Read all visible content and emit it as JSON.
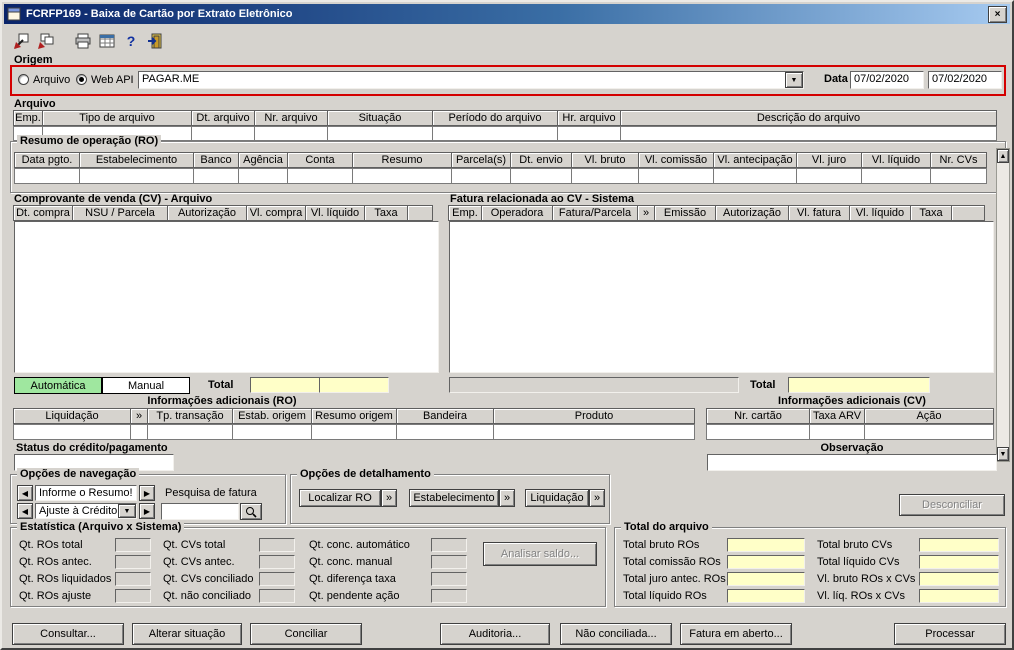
{
  "window": {
    "title": "FCRFP169 - Baixa de Cartão por Extrato Eletrônico"
  },
  "origem": {
    "label": "Origem",
    "options": [
      "Arquivo",
      "Web API"
    ],
    "selected": "Web API",
    "operadora": "PAGAR.ME",
    "data_label": "Data",
    "data_inicio": "07/02/2020",
    "data_fim": "07/02/2020"
  },
  "arquivo": {
    "label": "Arquivo",
    "columns": [
      "Emp.",
      "Tipo de arquivo",
      "Dt. arquivo",
      "Nr. arquivo",
      "Situação",
      "Período do arquivo",
      "Hr. arquivo",
      "Descrição do arquivo"
    ]
  },
  "resumo_ro": {
    "label": "Resumo de operação (RO)",
    "columns": [
      "Data pgto.",
      "Estabelecimento",
      "Banco",
      "Agência",
      "Conta",
      "Resumo",
      "Parcela(s)",
      "Dt. envio",
      "Vl. bruto",
      "Vl. comissão",
      "Vl. antecipação",
      "Vl. juro",
      "Vl. líquido",
      "Nr. CVs"
    ]
  },
  "cv_arquivo": {
    "label": "Comprovante de venda (CV) - Arquivo",
    "columns": [
      "Dt. compra",
      "NSU / Parcela",
      "Autorização",
      "Vl. compra",
      "Vl. líquido",
      "Taxa"
    ]
  },
  "fatura_sistema": {
    "label": "Fatura relacionada ao CV - Sistema",
    "columns": [
      "Emp.",
      "Operadora",
      "Fatura/Parcela",
      "»",
      "Emissão",
      "Autorização",
      "Vl. fatura",
      "Vl. líquido",
      "Taxa"
    ]
  },
  "conciliacao": {
    "automatica": "Automática",
    "manual": "Manual",
    "total_label": "Total"
  },
  "info_ro": {
    "label": "Informações adicionais (RO)",
    "columns": [
      "Liquidação",
      "»",
      "Tp. transação",
      "Estab. origem",
      "Resumo origem",
      "Bandeira",
      "Produto"
    ],
    "status_label": "Status do crédito/pagamento"
  },
  "info_cv": {
    "label": "Informações adicionais (CV)",
    "columns": [
      "Nr. cartão",
      "Taxa ARV",
      "Ação"
    ],
    "observacao_label": "Observação"
  },
  "navegacao": {
    "label": "Opções de navegação",
    "informe_resumo": "Informe o Resumo!",
    "ajuste_credito": "Ajuste à Crédito",
    "pesquisa_fatura": "Pesquisa de fatura"
  },
  "detalhamento": {
    "label": "Opções de detalhamento",
    "buttons": [
      "Localizar RO",
      "»",
      "Estabelecimento",
      "»",
      "Liquidação",
      "»"
    ]
  },
  "acoes": {
    "desconciliar": "Desconciliar",
    "analisar_saldo": "Analisar saldo..."
  },
  "estatistica": {
    "label": "Estatística (Arquivo x Sistema)",
    "col1": [
      "Qt. ROs total",
      "Qt. ROs antec.",
      "Qt. ROs liquidados",
      "Qt. ROs ajuste"
    ],
    "col2": [
      "Qt. CVs total",
      "Qt. CVs antec.",
      "Qt. CVs conciliado",
      "Qt. não conciliado"
    ],
    "col3": [
      "Qt. conc. automático",
      "Qt. conc. manual",
      "Qt. diferença taxa",
      "Qt. pendente ação"
    ]
  },
  "total_arquivo": {
    "label": "Total do arquivo",
    "left_labels": [
      "Total bruto ROs",
      "Total comissão ROs",
      "Total juro antec. ROs",
      "Total líquido ROs"
    ],
    "right_labels": [
      "Total bruto CVs",
      "Total líquido CVs",
      "Vl. bruto ROs x CVs",
      "Vl. líq. ROs x CVs"
    ]
  },
  "rodape": {
    "buttons": [
      "Consultar...",
      "Alterar situação",
      "Conciliar",
      "Auditoria...",
      "Não conciliada...",
      "Fatura em aberto...",
      "Processar"
    ]
  }
}
